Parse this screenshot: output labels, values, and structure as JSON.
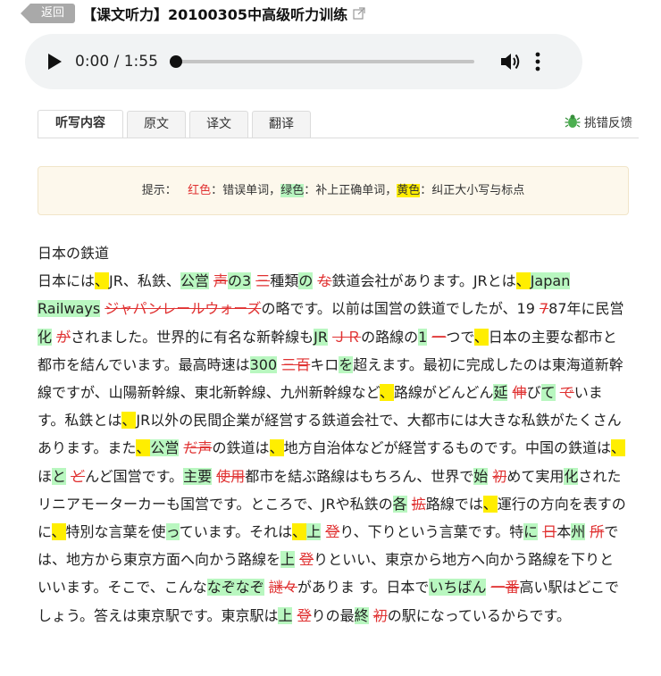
{
  "header": {
    "back_label": "返回",
    "title": "【课文听力】20100305中高级听力训练"
  },
  "player": {
    "time": "0:00 / 1:55",
    "progress": 0
  },
  "tabs": [
    "听写内容",
    "原文",
    "译文",
    "翻译"
  ],
  "report_label": "挑错反馈",
  "hint": {
    "prefix": "提示：",
    "red_word": "红色",
    "red_desc": "：错误单词，",
    "green_word": "绿色",
    "green_desc": "：补上正确单词，",
    "yellow_word": "黄色",
    "yellow_desc": "：纠正大小写与标点"
  },
  "content": {
    "title": "日本の鉄道",
    "segments": [
      [
        "t",
        "日本には"
      ],
      [
        "y",
        "、"
      ],
      [
        "t",
        "JR、私鉄、"
      ],
      [
        "g",
        "公営"
      ],
      [
        "t",
        " "
      ],
      [
        "r",
        "声"
      ],
      [
        "g",
        "の3"
      ],
      [
        "t",
        " "
      ],
      [
        "r",
        "三"
      ],
      [
        "t",
        "種類"
      ],
      [
        "g",
        "の"
      ],
      [
        "t",
        " "
      ],
      [
        "r",
        "な"
      ],
      [
        "t",
        "鉄道会社があります。JRとは"
      ],
      [
        "y",
        "、"
      ],
      [
        "g",
        "Japan Railways"
      ],
      [
        "t",
        "  "
      ],
      [
        "r",
        "ジャパンレールウォーズ"
      ],
      [
        "t",
        "の略です。以前は国営の鉄道でしたが、19 "
      ],
      [
        "r",
        "7"
      ],
      [
        "t",
        "87年に民営"
      ],
      [
        "g",
        "化"
      ],
      [
        "t",
        " "
      ],
      [
        "r",
        "が"
      ],
      [
        "t",
        "されました。世界的に有名な新幹線も"
      ],
      [
        "g",
        "JR"
      ],
      [
        "t",
        " "
      ],
      [
        "r",
        "ＪＲ"
      ],
      [
        "t",
        "の路線の"
      ],
      [
        "g",
        "1"
      ],
      [
        "t",
        "  "
      ],
      [
        "r",
        "一"
      ],
      [
        "t",
        "つで"
      ],
      [
        "y",
        "、"
      ],
      [
        "t",
        "日本の主要な都市と都市を結んでいます。最高時速は"
      ],
      [
        "g",
        "300"
      ],
      [
        "t",
        " "
      ],
      [
        "r",
        "三百"
      ],
      [
        "t",
        "キロ"
      ],
      [
        "g",
        "を"
      ],
      [
        "t",
        "超えます。最初に完成したのは東海道新幹線ですが、山陽新幹線、東北新幹線、九州新幹線など"
      ],
      [
        "y",
        "、"
      ],
      [
        "t",
        "路線がどんどん"
      ],
      [
        "g",
        "延"
      ],
      [
        "t",
        " "
      ],
      [
        "r",
        "伸"
      ],
      [
        "t",
        "び"
      ],
      [
        "g",
        "て"
      ],
      [
        "t",
        " "
      ],
      [
        "r",
        "で"
      ],
      [
        "t",
        "います。私鉄とは"
      ],
      [
        "y",
        "、"
      ],
      [
        "t",
        "JR以外の民間企業が経営する鉄道会社で、大都市には大きな私鉄がたくさんあります。また"
      ],
      [
        "y",
        "、"
      ],
      [
        "g",
        "公営"
      ],
      [
        "t",
        " "
      ],
      [
        "r",
        "だ声"
      ],
      [
        "t",
        "の鉄道は"
      ],
      [
        "y",
        "、"
      ],
      [
        "t",
        "地方自治体などが経営するものです。中国の鉄道は"
      ],
      [
        "y",
        "、"
      ],
      [
        "t",
        "ほ"
      ],
      [
        "g",
        "と"
      ],
      [
        "t",
        " "
      ],
      [
        "r",
        "ど"
      ],
      [
        "t",
        "んど国営です。"
      ],
      [
        "g",
        "主要"
      ],
      [
        "t",
        " "
      ],
      [
        "r",
        "使用"
      ],
      [
        "t",
        "都市を結ぶ路線はもちろん、世界で"
      ],
      [
        "g",
        "始"
      ],
      [
        "t",
        " "
      ],
      [
        "r",
        "初"
      ],
      [
        "t",
        "めて実用"
      ],
      [
        "g",
        "化"
      ],
      [
        "t",
        "されたリニアモーターカーも国営です。ところで、JRや私鉄の"
      ],
      [
        "g",
        "各"
      ],
      [
        "t",
        " "
      ],
      [
        "r",
        "拡"
      ],
      [
        "t",
        "路線では"
      ],
      [
        "y",
        "、"
      ],
      [
        "t",
        "運行の方向を表すのに"
      ],
      [
        "y",
        "、"
      ],
      [
        "t",
        "特別な言葉を使"
      ],
      [
        "g",
        "っ"
      ],
      [
        "t",
        "ています。それは"
      ],
      [
        "y",
        "、"
      ],
      [
        "g",
        "上"
      ],
      [
        "t",
        " "
      ],
      [
        "r",
        "登"
      ],
      [
        "t",
        "り、下りという言葉です。特"
      ],
      [
        "g",
        "に"
      ],
      [
        "t",
        " "
      ],
      [
        "r",
        "日"
      ],
      [
        "t",
        "本"
      ],
      [
        "g",
        "州"
      ],
      [
        "t",
        " "
      ],
      [
        "r",
        "所"
      ],
      [
        "t",
        "では、地方から東京方面へ向かう路線を"
      ],
      [
        "g",
        "上"
      ],
      [
        "t",
        " "
      ],
      [
        "r",
        "登"
      ],
      [
        "t",
        "りといい、東京から地方へ向かう路線を下りといいます。そこで、こんな"
      ],
      [
        "g",
        "なぞなぞ"
      ],
      [
        "t",
        " "
      ],
      [
        "r",
        "謎々"
      ],
      [
        "t",
        "がありま す。日本で"
      ],
      [
        "g",
        "いちばん"
      ],
      [
        "t",
        " "
      ],
      [
        "r",
        "一番"
      ],
      [
        "t",
        "高い駅はどこでしょう。答えは東京駅です。東京駅は"
      ],
      [
        "g",
        "上"
      ],
      [
        "t",
        " "
      ],
      [
        "r",
        "登"
      ],
      [
        "t",
        "りの最"
      ],
      [
        "g",
        "終"
      ],
      [
        "t",
        " "
      ],
      [
        "r",
        "初"
      ],
      [
        "t",
        "の駅になっているからです。"
      ]
    ]
  }
}
